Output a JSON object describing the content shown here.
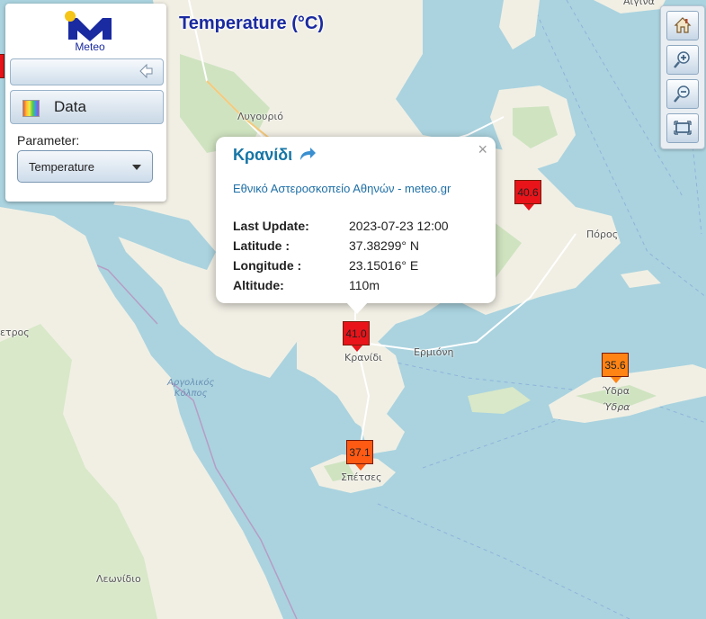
{
  "map": {
    "title": "Temperature (°C)",
    "place_labels": [
      "Λυγουριό",
      "Ερμιόνη",
      "Πόρος",
      "Κρανίδι",
      "Σπέτσες",
      "Ύδρα",
      "Ύδρα",
      "Λεωνίδιο",
      "Αίγινα",
      "ετρος"
    ],
    "sea_label": [
      "Αργολικός",
      "Κόλπος"
    ]
  },
  "panel": {
    "logo_text": "Meteo",
    "data_tab_label": "Data",
    "parameter_label": "Parameter:",
    "parameter_value": "Temperature"
  },
  "toolbar": {
    "icons": [
      "home-icon",
      "zoom-in-icon",
      "zoom-out-icon",
      "fit-extent-icon"
    ]
  },
  "stations": [
    {
      "value": "41.0",
      "color": "#e8141a"
    },
    {
      "value": "40.6",
      "color": "#e8141a"
    },
    {
      "value": "35.6",
      "color": "#ff8414"
    },
    {
      "value": "37.1",
      "color": "#ff5a14"
    }
  ],
  "popup": {
    "title": "Κρανίδι",
    "source_link": "Εθνικό Αστεροσκοπείο Αθηνών - meteo.gr",
    "close_label": "×",
    "rows": [
      {
        "label": "Last Update:",
        "value": "2023-07-23 12:00"
      },
      {
        "label": "Latitude :",
        "value": "37.38299° N"
      },
      {
        "label": "Longitude :",
        "value": "23.15016° E"
      },
      {
        "label": "Altitude:",
        "value": "110m"
      }
    ]
  }
}
